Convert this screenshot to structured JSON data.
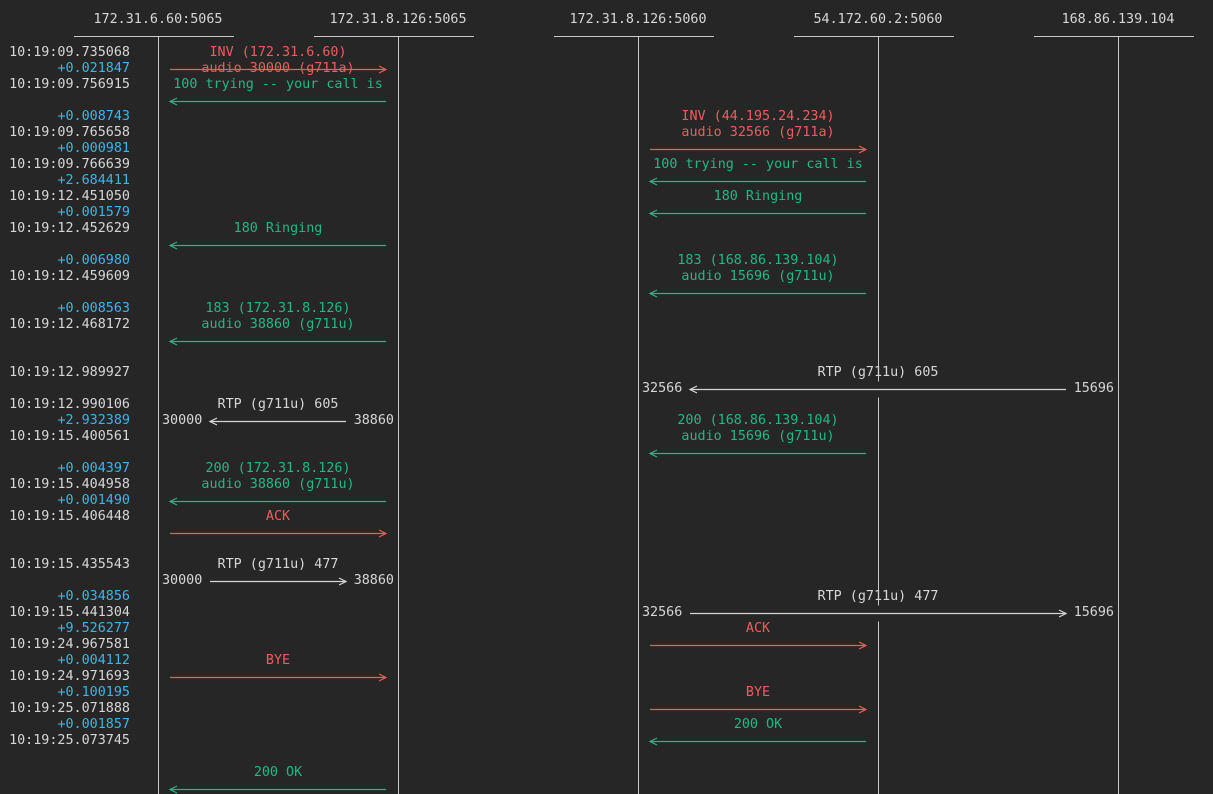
{
  "hosts": [
    "172.31.6.60:5065",
    "172.31.8.126:5065",
    "172.31.8.126:5060",
    "54.172.60.2:5060",
    "168.86.139.104"
  ],
  "colors": {
    "request": "#f05c5c",
    "response": "#1fb985",
    "media": "#d6d6d6",
    "delta": "#36b7f0",
    "background": "#262626"
  },
  "rows": [
    {
      "kind": "ts",
      "text": "10:19:09.735068"
    },
    {
      "kind": "delta",
      "text": "+0.021847"
    },
    {
      "kind": "ts",
      "text": "10:19:09.756915"
    },
    {
      "kind": "blank",
      "text": ""
    },
    {
      "kind": "delta",
      "text": "+0.008743"
    },
    {
      "kind": "ts",
      "text": "10:19:09.765658"
    },
    {
      "kind": "delta",
      "text": "+0.000981"
    },
    {
      "kind": "ts",
      "text": "10:19:09.766639"
    },
    {
      "kind": "delta",
      "text": "+2.684411"
    },
    {
      "kind": "ts",
      "text": "10:19:12.451050"
    },
    {
      "kind": "delta",
      "text": "+0.001579"
    },
    {
      "kind": "ts",
      "text": "10:19:12.452629"
    },
    {
      "kind": "blank",
      "text": ""
    },
    {
      "kind": "delta",
      "text": "+0.006980"
    },
    {
      "kind": "ts",
      "text": "10:19:12.459609"
    },
    {
      "kind": "blank",
      "text": ""
    },
    {
      "kind": "delta",
      "text": "+0.008563"
    },
    {
      "kind": "ts",
      "text": "10:19:12.468172"
    },
    {
      "kind": "blank",
      "text": ""
    },
    {
      "kind": "blank",
      "text": ""
    },
    {
      "kind": "ts",
      "text": "10:19:12.989927"
    },
    {
      "kind": "blank",
      "text": ""
    },
    {
      "kind": "ts",
      "text": "10:19:12.990106"
    },
    {
      "kind": "delta",
      "text": "+2.932389"
    },
    {
      "kind": "ts",
      "text": "10:19:15.400561"
    },
    {
      "kind": "blank",
      "text": ""
    },
    {
      "kind": "delta",
      "text": "+0.004397"
    },
    {
      "kind": "ts",
      "text": "10:19:15.404958"
    },
    {
      "kind": "delta",
      "text": "+0.001490"
    },
    {
      "kind": "ts",
      "text": "10:19:15.406448"
    },
    {
      "kind": "blank",
      "text": ""
    },
    {
      "kind": "blank",
      "text": ""
    },
    {
      "kind": "ts",
      "text": "10:19:15.435543"
    },
    {
      "kind": "blank",
      "text": ""
    },
    {
      "kind": "delta",
      "text": "+0.034856"
    },
    {
      "kind": "ts",
      "text": "10:19:15.441304"
    },
    {
      "kind": "delta",
      "text": "+9.526277"
    },
    {
      "kind": "ts",
      "text": "10:19:24.967581"
    },
    {
      "kind": "delta",
      "text": "+0.004112"
    },
    {
      "kind": "ts",
      "text": "10:19:24.971693"
    },
    {
      "kind": "delta",
      "text": "+0.100195"
    },
    {
      "kind": "ts",
      "text": "10:19:25.071888"
    },
    {
      "kind": "delta",
      "text": "+0.001857"
    },
    {
      "kind": "ts",
      "text": "10:19:25.073745"
    }
  ],
  "messages": [
    {
      "from": 0,
      "to": 1,
      "arrow_row": 1,
      "label_row": 0,
      "labels": [
        "INV (172.31.6.60)",
        "audio 30000 (g711a)"
      ],
      "type": "request"
    },
    {
      "from": 1,
      "to": 0,
      "arrow_row": 3,
      "label_row": 2,
      "labels": [
        "100 trying -- your call is"
      ],
      "type": "response"
    },
    {
      "from": 2,
      "to": 3,
      "arrow_row": 6,
      "label_row": 4,
      "labels": [
        "INV (44.195.24.234)",
        "audio 32566 (g711a)"
      ],
      "type": "request"
    },
    {
      "from": 3,
      "to": 2,
      "arrow_row": 8,
      "label_row": 7,
      "labels": [
        "100 trying -- your call is"
      ],
      "type": "response"
    },
    {
      "from": 3,
      "to": 2,
      "arrow_row": 10,
      "label_row": 9,
      "labels": [
        "180 Ringing"
      ],
      "type": "response"
    },
    {
      "from": 1,
      "to": 0,
      "arrow_row": 12,
      "label_row": 11,
      "labels": [
        "180 Ringing"
      ],
      "type": "response"
    },
    {
      "from": 3,
      "to": 2,
      "arrow_row": 15,
      "label_row": 13,
      "labels": [
        "183 (168.86.139.104)",
        "audio 15696 (g711u)"
      ],
      "type": "response"
    },
    {
      "from": 1,
      "to": 0,
      "arrow_row": 18,
      "label_row": 16,
      "labels": [
        "183 (172.31.8.126)",
        "audio 38860 (g711u)"
      ],
      "type": "response"
    },
    {
      "from": 3,
      "to": 2,
      "arrow_row": 25,
      "label_row": 23,
      "labels": [
        "200 (168.86.139.104)",
        "audio 15696 (g711u)"
      ],
      "type": "response"
    },
    {
      "from": 1,
      "to": 0,
      "arrow_row": 28,
      "label_row": 26,
      "labels": [
        "200 (172.31.8.126)",
        "audio 38860 (g711u)"
      ],
      "type": "response"
    },
    {
      "from": 0,
      "to": 1,
      "arrow_row": 30,
      "label_row": 29,
      "labels": [
        "ACK"
      ],
      "type": "request"
    },
    {
      "from": 2,
      "to": 3,
      "arrow_row": 37,
      "label_row": 36,
      "labels": [
        "ACK"
      ],
      "type": "request"
    },
    {
      "from": 0,
      "to": 1,
      "arrow_row": 39,
      "label_row": 38,
      "labels": [
        "BYE"
      ],
      "type": "request"
    },
    {
      "from": 2,
      "to": 3,
      "arrow_row": 41,
      "label_row": 40,
      "labels": [
        "BYE"
      ],
      "type": "request"
    },
    {
      "from": 3,
      "to": 2,
      "arrow_row": 43,
      "label_row": 42,
      "labels": [
        "200 OK"
      ],
      "type": "response"
    },
    {
      "from": 1,
      "to": 0,
      "arrow_row": 46,
      "label_row": 45,
      "labels": [
        "200 OK"
      ],
      "type": "response"
    }
  ],
  "rtp": [
    {
      "from": 4,
      "to": 2,
      "row": 21,
      "label": "RTP (g711u) 605",
      "left_port": "32566",
      "right_port": "15696"
    },
    {
      "from": 1,
      "to": 0,
      "row": 23,
      "label": "RTP (g711u) 605",
      "left_port": "30000",
      "right_port": "38860"
    },
    {
      "from": 0,
      "to": 1,
      "row": 33,
      "label": "RTP (g711u) 477",
      "left_port": "30000",
      "right_port": "38860"
    },
    {
      "from": 2,
      "to": 4,
      "row": 35,
      "label": "RTP (g711u) 477",
      "left_port": "32566",
      "right_port": "15696"
    }
  ]
}
